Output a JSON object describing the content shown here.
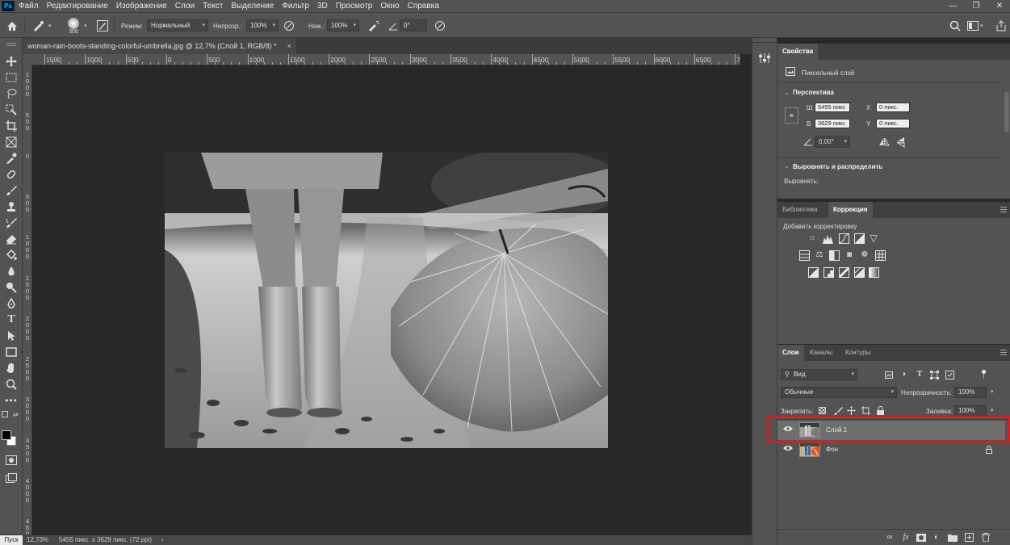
{
  "menubar": {
    "logo": "Ps",
    "items": [
      "Файл",
      "Редактирование",
      "Изображение",
      "Слои",
      "Текст",
      "Выделение",
      "Фильтр",
      "3D",
      "Просмотр",
      "Окно",
      "Справка"
    ],
    "window_controls": [
      "—",
      "❐",
      "✕"
    ]
  },
  "options": {
    "brush_size": "300",
    "mode_label": "Режим:",
    "mode_value": "Нормальный",
    "opacity_label": "Непрозр.:",
    "opacity_value": "100%",
    "pressure_label": "Наж.:",
    "pressure_value": "100%",
    "angle_value": "0°"
  },
  "document": {
    "tab_title": "woman-rain-boots-standing-colorful-umbrella.jpg @ 12,7% (Слой 1, RGB/8) *",
    "close": "×"
  },
  "ruler_top": [
    "1500",
    "1000",
    "500",
    "0",
    "500",
    "1000",
    "1500",
    "2000",
    "2500",
    "3000",
    "3500",
    "4000",
    "4500",
    "5000",
    "5500",
    "6000",
    "6500",
    "70"
  ],
  "ruler_left": [
    [
      "1",
      "0",
      "0",
      "0"
    ],
    [
      "5",
      "0",
      "0"
    ],
    [
      "0"
    ],
    [
      "5",
      "0",
      "0"
    ],
    [
      "1",
      "0",
      "0",
      "0"
    ],
    [
      "1",
      "5",
      "0",
      "0"
    ],
    [
      "2",
      "0",
      "0",
      "0"
    ],
    [
      "2",
      "5",
      "0",
      "0"
    ],
    [
      "3",
      "0",
      "0",
      "0"
    ],
    [
      "3",
      "5",
      "0",
      "0"
    ],
    [
      "4",
      "0",
      "0",
      "0"
    ],
    [
      "4",
      "5",
      "0",
      "0"
    ]
  ],
  "status": {
    "start": "Пуск",
    "zoom": "12,73%",
    "size": "5455 пикс. x 3629 пикс. (72 ppi)",
    "arrow": "›"
  },
  "properties": {
    "tab": "Свойства",
    "type": "Пиксельный слой",
    "section_perspective": "Перспектива",
    "w_label": "Ш",
    "w_value": "5455 пикс",
    "h_label": "В",
    "h_value": "3629 пикс",
    "x_label": "X",
    "x_value": "0 пикс.",
    "y_label": "Y",
    "y_value": "0 пикс.",
    "angle_value": "0,00°",
    "section_align": "Выровнять и распределить",
    "align_label": "Выровнять:"
  },
  "adjustments": {
    "tab_libraries": "Библиотеки",
    "tab_correction": "Коррекция",
    "add_label": "Добавить корректировку"
  },
  "layers": {
    "tab_layers": "Слои",
    "tab_channels": "Каналы",
    "tab_paths": "Контуры",
    "filter_kind": "Вид",
    "blend_mode": "Обычные",
    "opacity_label": "Непрозрачность:",
    "opacity_value": "100%",
    "lock_label": "Закрепить:",
    "fill_label": "Заливка:",
    "fill_value": "100%",
    "items": [
      {
        "name": "Слой 1",
        "selected": true
      },
      {
        "name": "Фон",
        "locked": true
      }
    ]
  },
  "colors": {
    "ui_bg": "#535353",
    "canvas_bg": "#282828",
    "highlight": "#d42020"
  }
}
